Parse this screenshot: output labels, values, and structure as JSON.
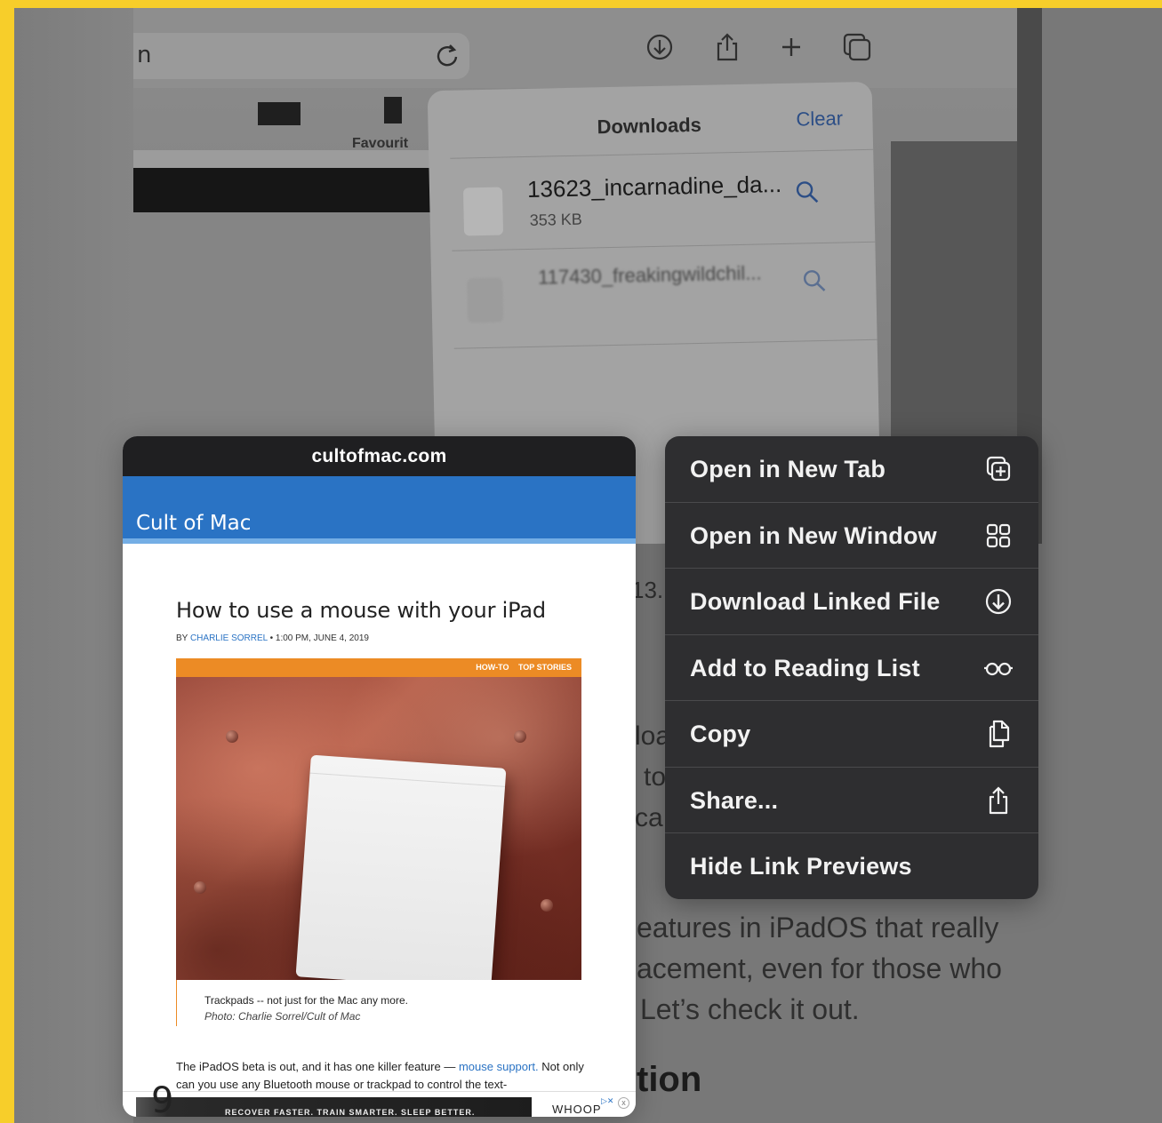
{
  "background_photo": {
    "url_fragment": "n",
    "favourites_label": "Favourit",
    "downloads": {
      "title": "Downloads",
      "clear_label": "Clear",
      "items": [
        {
          "name": "13623_incarnadine_da...",
          "size": "353 KB"
        },
        {
          "name": "117430_freakingwildchil..."
        }
      ]
    }
  },
  "article_background": {
    "fragment_13": "13.",
    "fragment_loa": "loa",
    "fragment_to": "to",
    "fragment_ca": "ca",
    "line1": "eatures in iPadOS that really",
    "line2": "acement, even for those who",
    "line3": "Let’s check it out.",
    "heading_fragment": "tion"
  },
  "preview": {
    "domain": "cultofmac.com",
    "site_name": "Cult of Mac",
    "article_title": "How to use a mouse with your iPad",
    "byline_prefix": "BY",
    "author": "CHARLIE SORREL",
    "byline_date": "• 1:00 PM, JUNE 4, 2019",
    "tags": [
      "HOW-TO",
      "TOP STORIES"
    ],
    "caption": "Trackpads -- not just for the Mac any more.",
    "photo_credit": "Photo: Charlie Sorrel/Cult of Mac",
    "body_part1": "The iPadOS beta is out, and it has one killer feature —",
    "body_link": "mouse support.",
    "body_part2": "Not only can you use any Bluetooth mouse or trackpad to control the text-",
    "ad_text": "RECOVER FASTER. TRAIN SMARTER. SLEEP BETTER.",
    "ad_brand": "WHOOP",
    "ad_close": "x",
    "page_number": "9"
  },
  "context_menu": {
    "items": [
      {
        "label": "Open in New Tab",
        "icon": "plus-square-on-square-icon"
      },
      {
        "label": "Open in New Window",
        "icon": "four-squares-icon"
      },
      {
        "label": "Download Linked File",
        "icon": "download-circle-icon"
      },
      {
        "label": "Add to Reading List",
        "icon": "eyeglasses-icon"
      },
      {
        "label": "Copy",
        "icon": "copy-docs-icon"
      },
      {
        "label": "Share...",
        "icon": "share-icon"
      },
      {
        "label": "Hide Link Previews",
        "icon": ""
      }
    ]
  },
  "colors": {
    "frame": "#f7ce2a",
    "site_header": "#2a73c4",
    "tag_bar": "#ec8b25",
    "menu_bg": "#2e2e30"
  }
}
